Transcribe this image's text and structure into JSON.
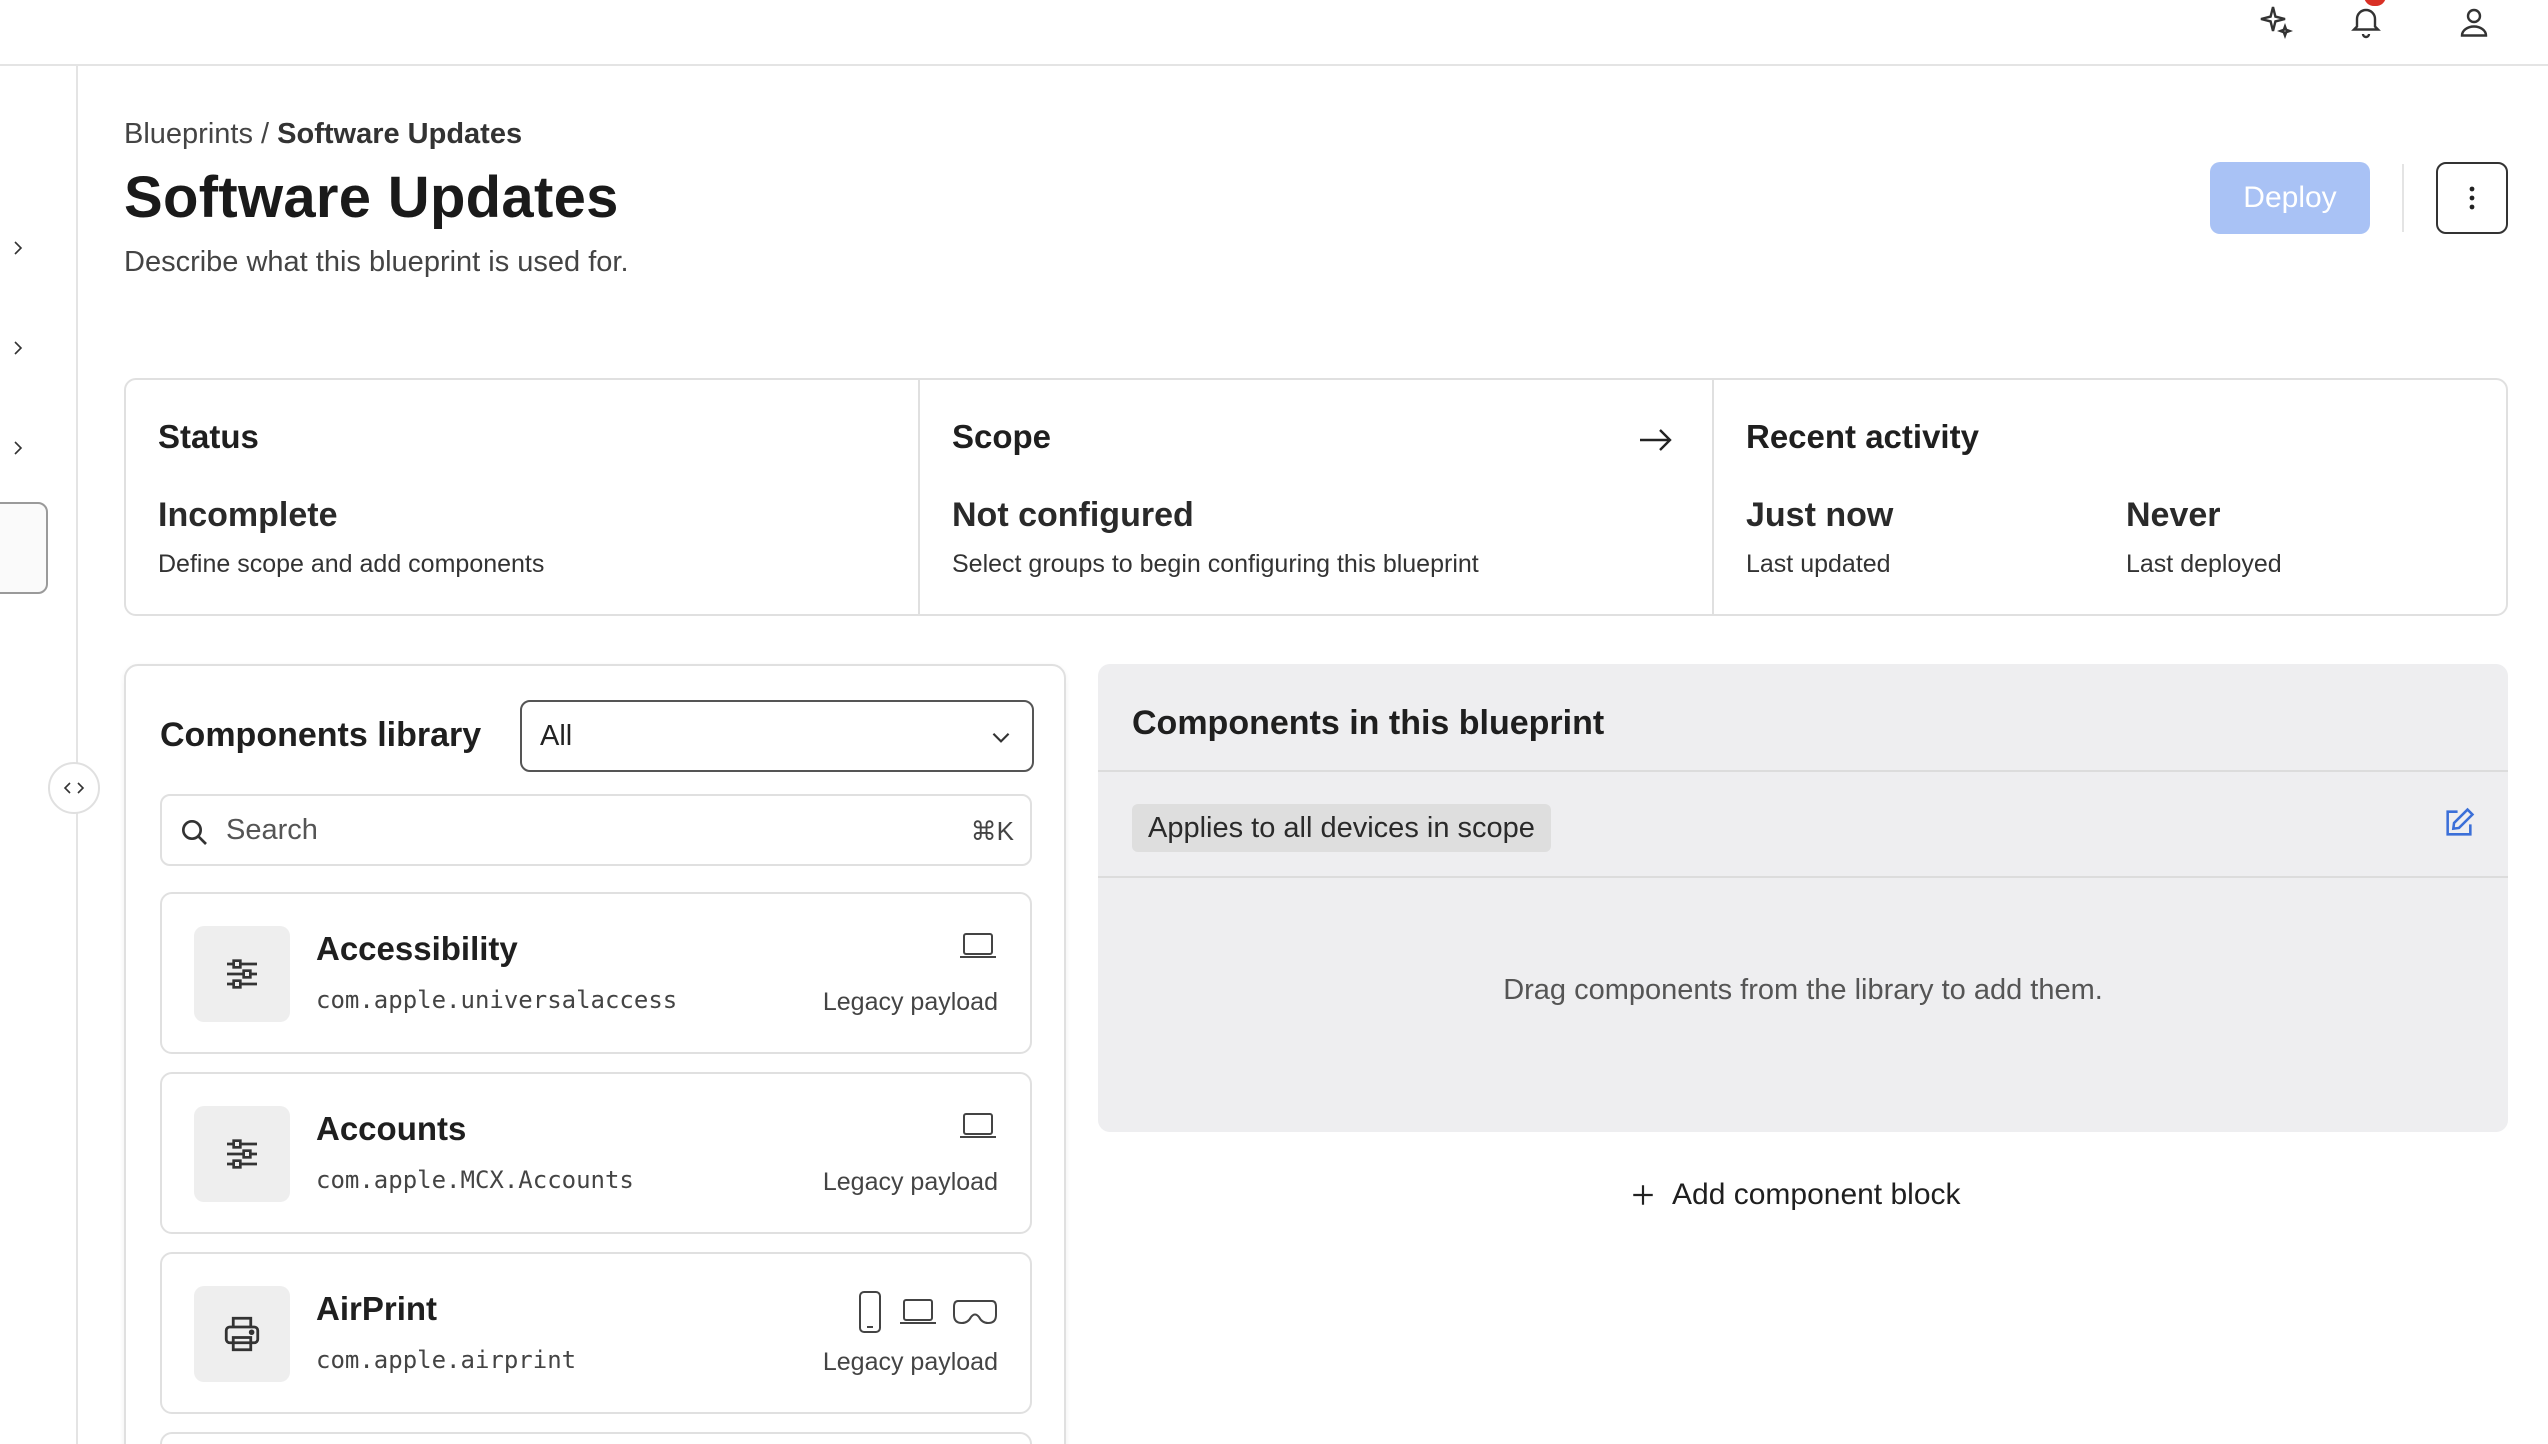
{
  "topbar": {
    "icons": [
      "sparkle-icon",
      "bell-icon",
      "user-icon"
    ]
  },
  "breadcrumb": {
    "root": "Blueprints",
    "separator": " / ",
    "current": "Software Updates"
  },
  "page": {
    "title": "Software Updates",
    "description": "Describe what this blueprint is used for."
  },
  "actions": {
    "deploy_label": "Deploy",
    "more_icon": "more-vertical-icon"
  },
  "summary": {
    "status": {
      "title": "Status",
      "value": "Incomplete",
      "sub": "Define scope and add components"
    },
    "scope": {
      "title": "Scope",
      "value": "Not configured",
      "sub": "Select groups to begin configuring this blueprint"
    },
    "activity": {
      "title": "Recent activity",
      "updated_value": "Just now",
      "updated_label": "Last updated",
      "deployed_value": "Never",
      "deployed_label": "Last deployed"
    }
  },
  "library": {
    "title": "Components library",
    "filter": {
      "selected": "All"
    },
    "search": {
      "placeholder": "Search",
      "shortcut": "⌘K"
    },
    "items": [
      {
        "name": "Accessibility",
        "id": "com.apple.universalaccess",
        "payload": "Legacy payload",
        "icon": "sliders-icon",
        "devices": [
          "laptop-icon"
        ]
      },
      {
        "name": "Accounts",
        "id": "com.apple.MCX.Accounts",
        "payload": "Legacy payload",
        "icon": "sliders-icon",
        "devices": [
          "laptop-icon"
        ]
      },
      {
        "name": "AirPrint",
        "id": "com.apple.airprint",
        "payload": "Legacy payload",
        "icon": "printer-icon",
        "devices": [
          "phone-icon",
          "laptop-icon",
          "vision-headset-icon"
        ]
      }
    ]
  },
  "blueprint": {
    "title": "Components in this blueprint",
    "scope_chip": "Applies to all devices in scope",
    "empty_text": "Drag components from the library to add them.",
    "add_block_label": "Add component block"
  }
}
